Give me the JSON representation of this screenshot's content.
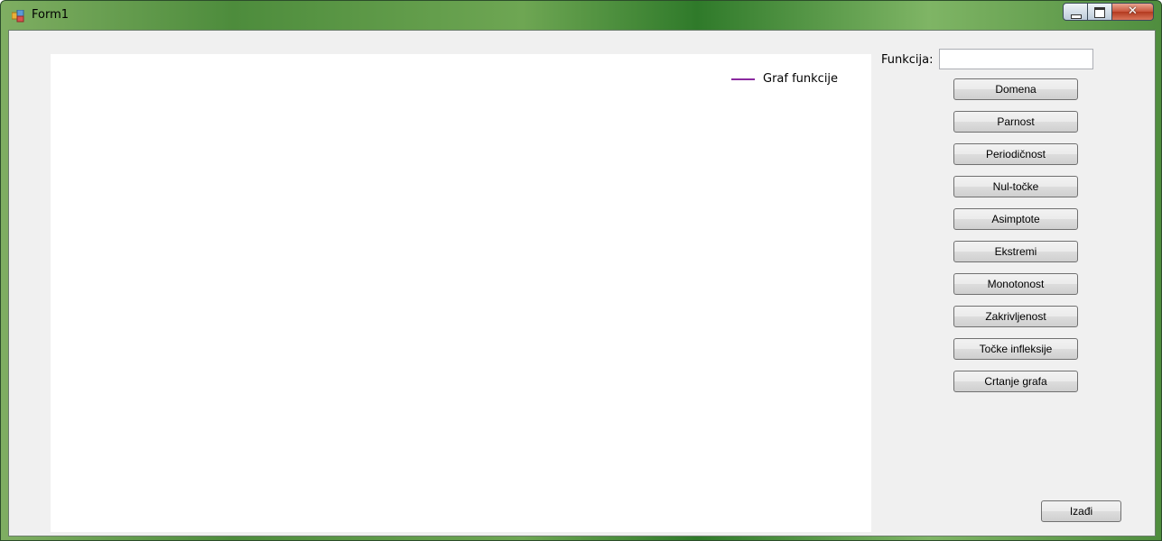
{
  "window": {
    "title": "Form1"
  },
  "chart": {
    "legend_label": "Graf funkcije",
    "series_color": "#8b2aa0"
  },
  "form": {
    "function_label": "Funkcija:",
    "function_value": ""
  },
  "buttons": [
    "Domena",
    "Parnost",
    "Periodičnost",
    "Nul-točke",
    "Asimptote",
    "Ekstremi",
    "Monotonost",
    "Zakrivljenost",
    "Točke infleksije",
    "Crtanje grafa"
  ],
  "exit_label": "Izađi",
  "icons": {
    "app": "app-form-icon",
    "minimize": "minimize-icon",
    "maximize": "maximize-icon",
    "close": "close-icon"
  }
}
